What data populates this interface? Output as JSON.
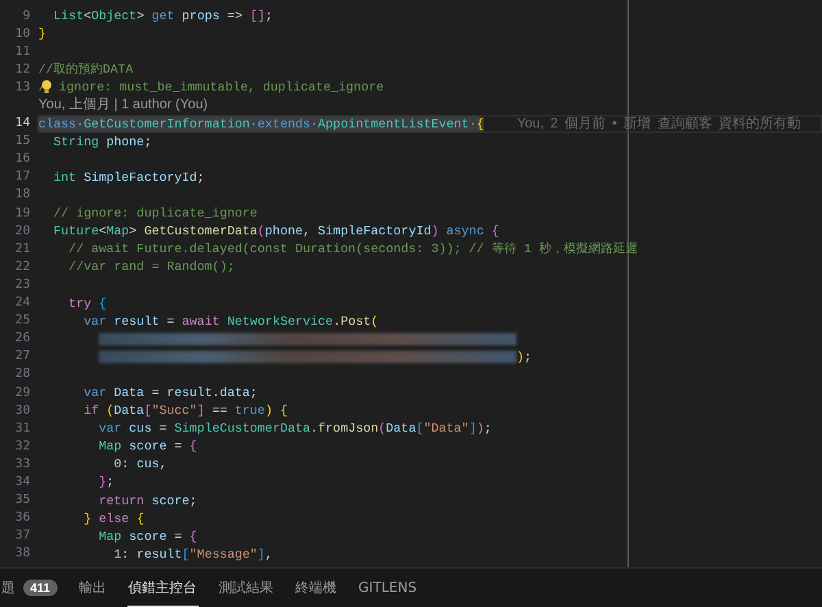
{
  "editor": {
    "lines": [
      {
        "kind": "code",
        "number": "9",
        "selected": false,
        "tokens": [
          {
            "text": "  List",
            "kind": "type"
          },
          {
            "text": "<",
            "kind": "plain"
          },
          {
            "text": "Object",
            "kind": "type"
          },
          {
            "text": "> ",
            "kind": "plain"
          },
          {
            "text": "get",
            "kind": "keyword"
          },
          {
            "text": " props",
            "kind": "var"
          },
          {
            "text": " => ",
            "kind": "plain"
          },
          {
            "text": "[]",
            "kind": "b2"
          },
          {
            "text": ";",
            "kind": "plain"
          }
        ]
      },
      {
        "kind": "code",
        "number": "10",
        "selected": false,
        "tokens": [
          {
            "text": "}",
            "kind": "b1"
          }
        ]
      },
      {
        "kind": "code",
        "number": "11",
        "selected": false
      },
      {
        "kind": "code",
        "number": "12",
        "selected": false,
        "tokens": [
          {
            "text": "//取的預約DATA",
            "kind": "comment"
          }
        ]
      },
      {
        "kind": "code",
        "number": "13",
        "selected": false,
        "bulb": true,
        "tokens": [
          {
            "text": "/",
            "kind": "comment"
          },
          {
            "text": " ignore: must_be_immutable, duplicate_ignore",
            "kind": "comment"
          }
        ]
      },
      {
        "kind": "codelens",
        "text": "You, 上個月 | 1 author (You)"
      },
      {
        "kind": "code",
        "number": "14",
        "selected": true,
        "blame": "You, 2 個月前 • 新增 查詢顧客 資料的所有動",
        "tokens": [
          {
            "text": "class",
            "kind": "keyword"
          },
          {
            "text": "·",
            "kind": "space"
          },
          {
            "text": "GetCustomerInformation",
            "kind": "type"
          },
          {
            "text": "·",
            "kind": "space"
          },
          {
            "text": "extends",
            "kind": "keyword"
          },
          {
            "text": "·",
            "kind": "space"
          },
          {
            "text": "AppointmentListEvent",
            "kind": "type"
          },
          {
            "text": "·",
            "kind": "space"
          },
          {
            "text": "{",
            "kind": "b1"
          }
        ]
      },
      {
        "kind": "code",
        "number": "15",
        "selected": false,
        "tokens": [
          {
            "text": "  String",
            "kind": "type"
          },
          {
            "text": " phone",
            "kind": "var"
          },
          {
            "text": ";",
            "kind": "plain"
          }
        ]
      },
      {
        "kind": "code",
        "number": "16",
        "selected": false
      },
      {
        "kind": "code",
        "number": "17",
        "selected": false,
        "tokens": [
          {
            "text": "  int",
            "kind": "type"
          },
          {
            "text": " SimpleFactoryId",
            "kind": "var"
          },
          {
            "text": ";",
            "kind": "plain"
          }
        ]
      },
      {
        "kind": "code",
        "number": "18",
        "selected": false
      },
      {
        "kind": "code",
        "number": "19",
        "selected": false,
        "tokens": [
          {
            "text": "  // ignore: duplicate_ignore",
            "kind": "comment"
          }
        ]
      },
      {
        "kind": "code",
        "number": "20",
        "selected": false,
        "tokens": [
          {
            "text": "  Future",
            "kind": "type"
          },
          {
            "text": "<",
            "kind": "plain"
          },
          {
            "text": "Map",
            "kind": "type"
          },
          {
            "text": "> ",
            "kind": "plain"
          },
          {
            "text": "GetCustomerData",
            "kind": "func"
          },
          {
            "text": "(",
            "kind": "b2"
          },
          {
            "text": "phone",
            "kind": "var"
          },
          {
            "text": ", ",
            "kind": "plain"
          },
          {
            "text": "SimpleFactoryId",
            "kind": "var"
          },
          {
            "text": ")",
            "kind": "b2"
          },
          {
            "text": " async ",
            "kind": "keyword"
          },
          {
            "text": "{",
            "kind": "b2"
          }
        ]
      },
      {
        "kind": "code",
        "number": "21",
        "selected": false,
        "tokens": [
          {
            "text": "    // await Future.delayed(const Duration(seconds: 3)); // 等待 1 秒，模擬網路延遲",
            "kind": "comment"
          }
        ]
      },
      {
        "kind": "code",
        "number": "22",
        "selected": false,
        "tokens": [
          {
            "text": "    //var rand = Random();",
            "kind": "comment"
          }
        ]
      },
      {
        "kind": "code",
        "number": "23",
        "selected": false
      },
      {
        "kind": "code",
        "number": "24",
        "selected": false,
        "tokens": [
          {
            "text": "    try",
            "kind": "control"
          },
          {
            "text": " {",
            "kind": "b3"
          }
        ]
      },
      {
        "kind": "code",
        "number": "25",
        "selected": false,
        "tokens": [
          {
            "text": "      var",
            "kind": "keyword"
          },
          {
            "text": " result",
            "kind": "var"
          },
          {
            "text": " = ",
            "kind": "plain"
          },
          {
            "text": "await",
            "kind": "control"
          },
          {
            "text": " NetworkService",
            "kind": "type"
          },
          {
            "text": ".",
            "kind": "plain"
          },
          {
            "text": "Post",
            "kind": "func"
          },
          {
            "text": "(",
            "kind": "b1"
          }
        ]
      },
      {
        "kind": "code",
        "number": "26",
        "selected": false,
        "tokens": [
          {
            "kind": "redacted"
          }
        ]
      },
      {
        "kind": "code",
        "number": "27",
        "selected": false,
        "tokens": [
          {
            "kind": "redacted"
          },
          {
            "text": ")",
            "kind": "b1"
          },
          {
            "text": ";",
            "kind": "plain"
          }
        ]
      },
      {
        "kind": "code",
        "number": "28",
        "selected": false
      },
      {
        "kind": "code",
        "number": "29",
        "selected": false,
        "tokens": [
          {
            "text": "      var",
            "kind": "keyword"
          },
          {
            "text": " Data",
            "kind": "var"
          },
          {
            "text": " = ",
            "kind": "plain"
          },
          {
            "text": "result",
            "kind": "var"
          },
          {
            "text": ".",
            "kind": "plain"
          },
          {
            "text": "data",
            "kind": "var"
          },
          {
            "text": ";",
            "kind": "plain"
          }
        ]
      },
      {
        "kind": "code",
        "number": "30",
        "selected": false,
        "tokens": [
          {
            "text": "      if",
            "kind": "control"
          },
          {
            "text": " (",
            "kind": "b1"
          },
          {
            "text": "Data",
            "kind": "var"
          },
          {
            "text": "[",
            "kind": "b2"
          },
          {
            "text": "\"Succ\"",
            "kind": "string"
          },
          {
            "text": "]",
            "kind": "b2"
          },
          {
            "text": " == ",
            "kind": "plain"
          },
          {
            "text": "true",
            "kind": "keyword"
          },
          {
            "text": ")",
            "kind": "b1"
          },
          {
            "text": " {",
            "kind": "b1"
          }
        ]
      },
      {
        "kind": "code",
        "number": "31",
        "selected": false,
        "tokens": [
          {
            "text": "        var",
            "kind": "keyword"
          },
          {
            "text": " cus",
            "kind": "var"
          },
          {
            "text": " = ",
            "kind": "plain"
          },
          {
            "text": "SimpleCustomerData",
            "kind": "type"
          },
          {
            "text": ".",
            "kind": "plain"
          },
          {
            "text": "fromJson",
            "kind": "func"
          },
          {
            "text": "(",
            "kind": "b2"
          },
          {
            "text": "Data",
            "kind": "var"
          },
          {
            "text": "[",
            "kind": "b3"
          },
          {
            "text": "\"Data\"",
            "kind": "string"
          },
          {
            "text": "]",
            "kind": "b3"
          },
          {
            "text": ")",
            "kind": "b2"
          },
          {
            "text": ";",
            "kind": "plain"
          }
        ]
      },
      {
        "kind": "code",
        "number": "32",
        "selected": false,
        "tokens": [
          {
            "text": "        Map",
            "kind": "type"
          },
          {
            "text": " score",
            "kind": "var"
          },
          {
            "text": " = ",
            "kind": "plain"
          },
          {
            "text": "{",
            "kind": "b2"
          }
        ]
      },
      {
        "kind": "code",
        "number": "33",
        "selected": false,
        "tokens": [
          {
            "text": "          0",
            "kind": "number"
          },
          {
            "text": ": ",
            "kind": "plain"
          },
          {
            "text": "cus",
            "kind": "var"
          },
          {
            "text": ",",
            "kind": "plain"
          }
        ]
      },
      {
        "kind": "code",
        "number": "34",
        "selected": false,
        "tokens": [
          {
            "text": "        }",
            "kind": "b2"
          },
          {
            "text": ";",
            "kind": "plain"
          }
        ]
      },
      {
        "kind": "code",
        "number": "35",
        "selected": false,
        "tokens": [
          {
            "text": "        return",
            "kind": "control"
          },
          {
            "text": " score",
            "kind": "var"
          },
          {
            "text": ";",
            "kind": "plain"
          }
        ]
      },
      {
        "kind": "code",
        "number": "36",
        "selected": false,
        "tokens": [
          {
            "text": "      }",
            "kind": "b1"
          },
          {
            "text": " else",
            "kind": "control"
          },
          {
            "text": " {",
            "kind": "b1"
          }
        ]
      },
      {
        "kind": "code",
        "number": "37",
        "selected": false,
        "tokens": [
          {
            "text": "        Map",
            "kind": "type"
          },
          {
            "text": " score",
            "kind": "var"
          },
          {
            "text": " = ",
            "kind": "plain"
          },
          {
            "text": "{",
            "kind": "b2"
          }
        ]
      },
      {
        "kind": "code",
        "number": "38",
        "selected": false,
        "tokens": [
          {
            "text": "          1",
            "kind": "number"
          },
          {
            "text": ": ",
            "kind": "plain"
          },
          {
            "text": "result",
            "kind": "var"
          },
          {
            "text": "[",
            "kind": "b3"
          },
          {
            "text": "\"Message\"",
            "kind": "string"
          },
          {
            "text": "]",
            "kind": "b3"
          },
          {
            "text": ",",
            "kind": "plain"
          }
        ]
      }
    ]
  },
  "panel": {
    "tabs": [
      {
        "label": "題",
        "badge": "411",
        "selected": false
      },
      {
        "label": "輸出",
        "selected": false
      },
      {
        "label": "偵錯主控台",
        "selected": true
      },
      {
        "label": "測試結果",
        "selected": false
      },
      {
        "label": "終端機",
        "selected": false
      },
      {
        "label": "GITLENS",
        "selected": false
      }
    ]
  }
}
